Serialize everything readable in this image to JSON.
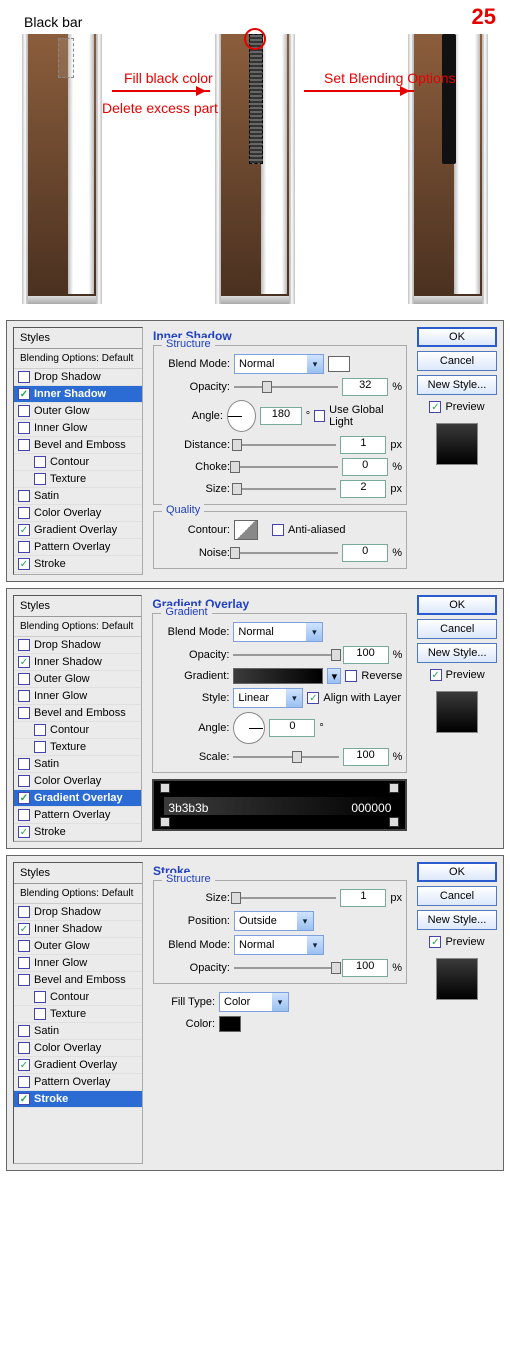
{
  "step": {
    "number": "25",
    "title": "Black bar",
    "anno1": "Fill black color",
    "anno2": "Delete excess part",
    "anno3": "Set Blending Options"
  },
  "common": {
    "styles_title": "Styles",
    "blend_default": "Blending Options: Default",
    "ok": "OK",
    "cancel": "Cancel",
    "newstyle": "New Style...",
    "preview": "Preview"
  },
  "style_items": [
    {
      "label": "Drop Shadow",
      "checked": false
    },
    {
      "label": "Inner Shadow",
      "checked": true
    },
    {
      "label": "Outer Glow",
      "checked": false
    },
    {
      "label": "Inner Glow",
      "checked": false
    },
    {
      "label": "Bevel and Emboss",
      "checked": false
    },
    {
      "label": "Contour",
      "checked": false,
      "child": true,
      "nocheck": false
    },
    {
      "label": "Texture",
      "checked": false,
      "child": true,
      "nocheck": false
    },
    {
      "label": "Satin",
      "checked": false
    },
    {
      "label": "Color Overlay",
      "checked": false
    },
    {
      "label": "Gradient Overlay",
      "checked": true
    },
    {
      "label": "Pattern Overlay",
      "checked": false
    },
    {
      "label": "Stroke",
      "checked": true
    }
  ],
  "panel1": {
    "title": "Inner Shadow",
    "structure": "Structure",
    "blendmode_lbl": "Blend Mode:",
    "blendmode": "Normal",
    "opacity_lbl": "Opacity:",
    "opacity": "32",
    "angle_lbl": "Angle:",
    "angle": "180",
    "angle_unit": "°",
    "global": "Use Global Light",
    "distance_lbl": "Distance:",
    "distance": "1",
    "px": "px",
    "choke_lbl": "Choke:",
    "choke": "0",
    "pct": "%",
    "size_lbl": "Size:",
    "size": "2",
    "quality": "Quality",
    "contour_lbl": "Contour:",
    "aa": "Anti-aliased",
    "noise_lbl": "Noise:",
    "noise": "0"
  },
  "panel2": {
    "title": "Gradient Overlay",
    "sub": "Gradient",
    "blendmode_lbl": "Blend Mode:",
    "blendmode": "Normal",
    "opacity_lbl": "Opacity:",
    "opacity": "100",
    "pct": "%",
    "gradient_lbl": "Gradient:",
    "reverse": "Reverse",
    "style_lbl": "Style:",
    "style": "Linear",
    "align": "Align with Layer",
    "angle_lbl": "Angle:",
    "angle": "0",
    "angle_unit": "°",
    "scale_lbl": "Scale:",
    "scale": "100",
    "stop_left": "3b3b3b",
    "stop_right": "000000"
  },
  "panel3": {
    "title": "Stroke",
    "structure": "Structure",
    "size_lbl": "Size:",
    "size": "1",
    "px": "px",
    "position_lbl": "Position:",
    "position": "Outside",
    "blendmode_lbl": "Blend Mode:",
    "blendmode": "Normal",
    "opacity_lbl": "Opacity:",
    "opacity": "100",
    "pct": "%",
    "filltype_lbl": "Fill Type:",
    "filltype": "Color",
    "color_lbl": "Color:",
    "color": "#000000"
  }
}
